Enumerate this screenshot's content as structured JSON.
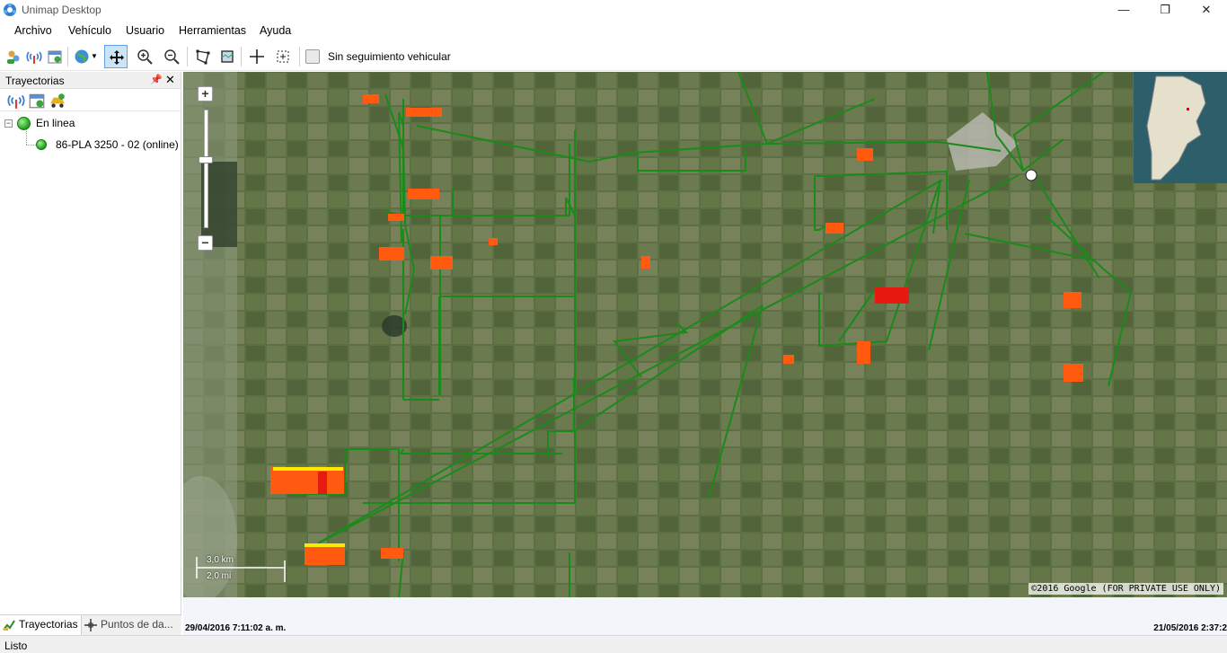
{
  "window": {
    "title": "Unimap Desktop"
  },
  "menu": [
    "Archivo",
    "Vehículo",
    "Usuario",
    "Herramientas",
    "Ayuda"
  ],
  "toolbar": {
    "tracking_label": "Sin seguimiento vehicular",
    "tracking_checked": false
  },
  "panel": {
    "title": "Trayectorias",
    "group_label": "En linea",
    "vehicle_label": "86-PLA 3250 - 02 (online)",
    "tabs": [
      "Trayectorias",
      "Puntos de da..."
    ]
  },
  "map": {
    "scale_km": "3,0 km",
    "scale_mi": "2,0 mi",
    "copyright": "©2016 Google (FOR PRIVATE USE ONLY)",
    "track_color": "#1a8a1a"
  },
  "timeline": {
    "start": "29/04/2016 7:11:02 a. m.",
    "end": "21/05/2016 2:37:2"
  },
  "status": "Listo"
}
